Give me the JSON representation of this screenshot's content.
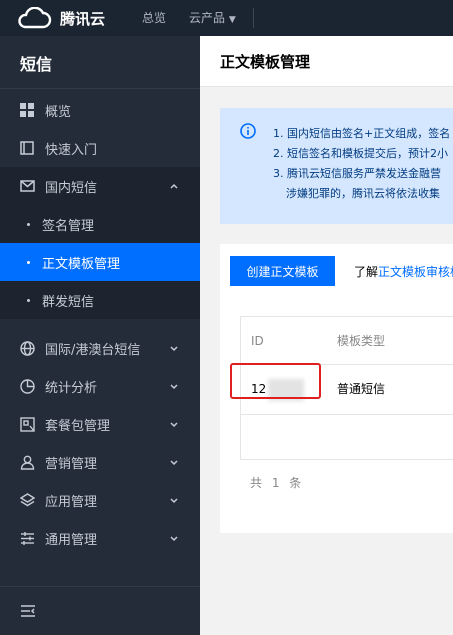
{
  "topbar": {
    "logo_text": "腾讯云",
    "nav_overview": "总览",
    "nav_products": "云产品"
  },
  "sidebar": {
    "title": "短信",
    "items": [
      {
        "label": "概览",
        "icon": "grid-icon"
      },
      {
        "label": "快速入门",
        "icon": "book-icon"
      },
      {
        "label": "国内短信",
        "icon": "mail-icon",
        "expanded": true
      },
      {
        "label": "国际/港澳台短信",
        "icon": "globe-icon"
      },
      {
        "label": "统计分析",
        "icon": "pie-chart-icon"
      },
      {
        "label": "套餐包管理",
        "icon": "package-icon"
      },
      {
        "label": "营销管理",
        "icon": "user-icon"
      },
      {
        "label": "应用管理",
        "icon": "layers-icon"
      },
      {
        "label": "通用管理",
        "icon": "sliders-icon"
      }
    ],
    "sub_items": [
      {
        "label": "签名管理",
        "active": false
      },
      {
        "label": "正文模板管理",
        "active": true
      },
      {
        "label": "群发短信",
        "active": false
      }
    ]
  },
  "main": {
    "page_title": "正文模板管理",
    "notice_lines": [
      "1. 国内短信由签名+正文组成，签名",
      "2. 短信签名和模板提交后，预计2小",
      "3. 腾讯云短信服务严禁发送金融营",
      "涉嫌犯罪的，腾讯云将依法收集"
    ],
    "create_button": "创建正文模板",
    "learn_prefix": "了解",
    "learn_link": "正文模板审核标",
    "table": {
      "headers": [
        "ID",
        "模板类型"
      ],
      "rows": [
        {
          "id": "12",
          "type": "普通短信"
        }
      ]
    },
    "total_text": "共 1 条"
  },
  "colors": {
    "topbar_bg": "#1b2431",
    "sidebar_bg": "#242c39",
    "accent": "#006eff",
    "notice_bg": "#d5e7fe",
    "highlight_border": "#e02020"
  }
}
